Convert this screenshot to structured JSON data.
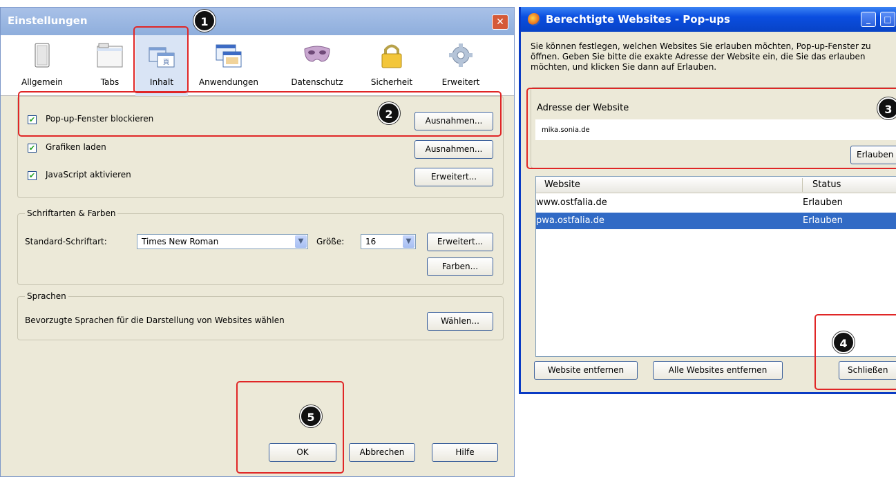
{
  "left": {
    "title": "Einstellungen",
    "close_glyph": "✕",
    "toolbar": [
      {
        "label": "Allgemein",
        "icon": "general-icon"
      },
      {
        "label": "Tabs",
        "icon": "tabs-icon"
      },
      {
        "label": "Inhalt",
        "icon": "content-icon",
        "selected": true
      },
      {
        "label": "Anwendungen",
        "icon": "applications-icon"
      },
      {
        "label": "Datenschutz",
        "icon": "privacy-mask-icon"
      },
      {
        "label": "Sicherheit",
        "icon": "padlock-icon"
      },
      {
        "label": "Erweitert",
        "icon": "gear-icon"
      }
    ],
    "content": {
      "popup_checkbox": "Pop-up-Fenster blockieren",
      "images_checkbox": "Grafiken laden",
      "js_checkbox": "JavaScript aktivieren",
      "check_glyph": "✔",
      "exceptions_btn_1": "Ausnahmen...",
      "exceptions_btn_2": "Ausnahmen...",
      "advanced_js_btn": "Erweitert...",
      "fonts_group_title": "Schriftarten & Farben",
      "default_font_label": "Standard-Schriftart:",
      "default_font_value": "Times New Roman",
      "size_label": "Größe:",
      "size_value": "16",
      "fonts_advanced_btn": "Erweitert...",
      "colors_btn": "Farben...",
      "languages_group_title": "Sprachen",
      "languages_text": "Bevorzugte Sprachen für die Darstellung von Websites wählen",
      "choose_btn": "Wählen..."
    },
    "footer": {
      "ok": "OK",
      "cancel": "Abbrechen",
      "help": "Hilfe"
    }
  },
  "right": {
    "title": "Berechtigte Websites - Pop-ups",
    "description": "Sie können festlegen, welchen Websites Sie erlauben möchten, Pop-up-Fenster zu öffnen. Geben Sie bitte die exakte Adresse der Website ein, die Sie das erlauben möchten, und klicken Sie dann auf Erlauben.",
    "address_label": "Adresse der Website",
    "address_value": "mika.sonia.de",
    "allow_btn": "Erlauben",
    "columns": [
      "Website",
      "Status"
    ],
    "rows": [
      {
        "site": "www.ostfalia.de",
        "status": "Erlauben",
        "selected": false
      },
      {
        "site": "pwa.ostfalia.de",
        "status": "Erlauben",
        "selected": true
      }
    ],
    "remove_btn": "Website entfernen",
    "remove_all_btn": "Alle Websites entfernen",
    "close_btn": "Schließen",
    "minimize_glyph": "_",
    "maximize_glyph": "□"
  },
  "annotations": {
    "step1": "1",
    "step2": "2",
    "step3": "3",
    "step4": "4",
    "step5": "5",
    "highlight_color": "#e02626"
  }
}
